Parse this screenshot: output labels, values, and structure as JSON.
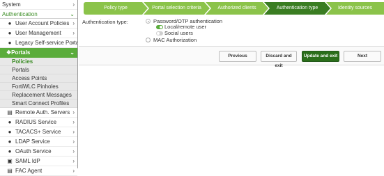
{
  "sidebar": {
    "top": "System",
    "section": "Authentication",
    "items": [
      {
        "label": "User Account Policies",
        "icon": "user-icon"
      },
      {
        "label": "User Management",
        "icon": "users-icon"
      },
      {
        "label": "Legacy Self-service Portal",
        "icon": "user-icon"
      }
    ],
    "portals": {
      "label": "Portals",
      "icon": "portal-icon"
    },
    "portal_subitems": [
      "Policies",
      "Portals",
      "Access Points",
      "FortiWLC Pinholes",
      "Replacement Messages",
      "Smart Connect Profiles"
    ],
    "more_items": [
      {
        "label": "Remote Auth. Servers",
        "icon": "server-icon"
      },
      {
        "label": "RADIUS Service",
        "icon": "radius-icon"
      },
      {
        "label": "TACACS+ Service",
        "icon": "tacacs-icon"
      },
      {
        "label": "LDAP Service",
        "icon": "ldap-icon"
      },
      {
        "label": "OAuth Service",
        "icon": "oauth-icon"
      },
      {
        "label": "SAML IdP",
        "icon": "saml-icon"
      },
      {
        "label": "FAC Agent",
        "icon": "agent-icon"
      }
    ]
  },
  "wizard": {
    "steps": [
      "Policy type",
      "Portal selection criteria",
      "Authorized clients",
      "Authentication type",
      "Identity sources"
    ],
    "current_step": "Authentication type"
  },
  "form": {
    "label": "Authentication type:",
    "option_password": "Password/OTP authentication",
    "local_remote_user": "Local/remote user",
    "social_users": "Social users",
    "option_mac": "MAC Authorization"
  },
  "buttons": {
    "previous": "Previous",
    "discard": "Discard and exit",
    "update": "Update and exit",
    "next": "Next"
  },
  "colors": {
    "accent": "#5aac3b",
    "step_done": "#8bc34a",
    "step_current": "#3a7d22",
    "primary_button": "#2a6e1a"
  }
}
